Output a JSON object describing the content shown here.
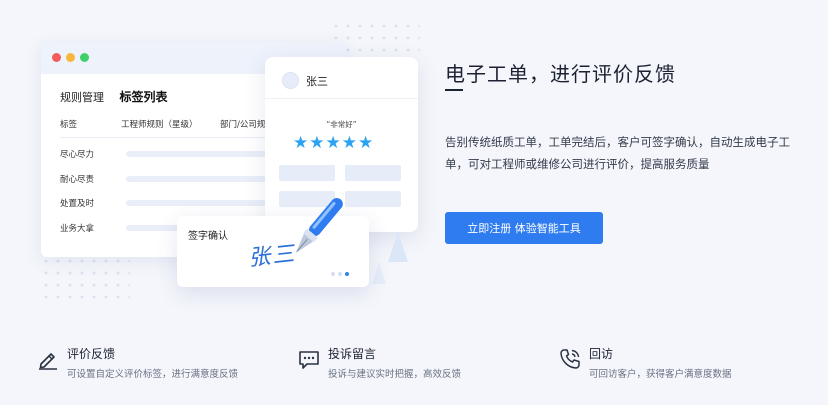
{
  "illustration": {
    "window": {
      "tabs": [
        "规则管理",
        "标签列表"
      ],
      "columns": [
        "标签",
        "工程师规则（星级）",
        "部门/公司规"
      ],
      "rows": [
        "尽心尽力",
        "耐心尽责",
        "处置及时",
        "业务大拿"
      ]
    },
    "rating_card": {
      "user_name": "张三",
      "rating_label": "“非常好”",
      "stars": "★★★★★",
      "star_count": 5
    },
    "signature_card": {
      "title": "签字确认",
      "signature": "张三"
    }
  },
  "hero": {
    "title": "电子工单，进行评价反馈",
    "description": "告别传统纸质工单，工单完结后，客户可签字确认，自动生成电子工单，可对工程师或维修公司进行评价，提高服务质量",
    "cta_label": "立即注册 体验智能工具"
  },
  "features": [
    {
      "icon": "pen-icon",
      "title": "评价反馈",
      "desc": "可设置自定义评价标签，进行满意度反馈"
    },
    {
      "icon": "message-icon",
      "title": "投诉留言",
      "desc": "投诉与建议实时把握，高效反馈"
    },
    {
      "icon": "phone-icon",
      "title": "回访",
      "desc": "可回访客户，获得客户满意度数据"
    }
  ],
  "colors": {
    "accent": "#2f7cf0",
    "star": "#2ea3f0",
    "background": "#f4f6fb"
  }
}
